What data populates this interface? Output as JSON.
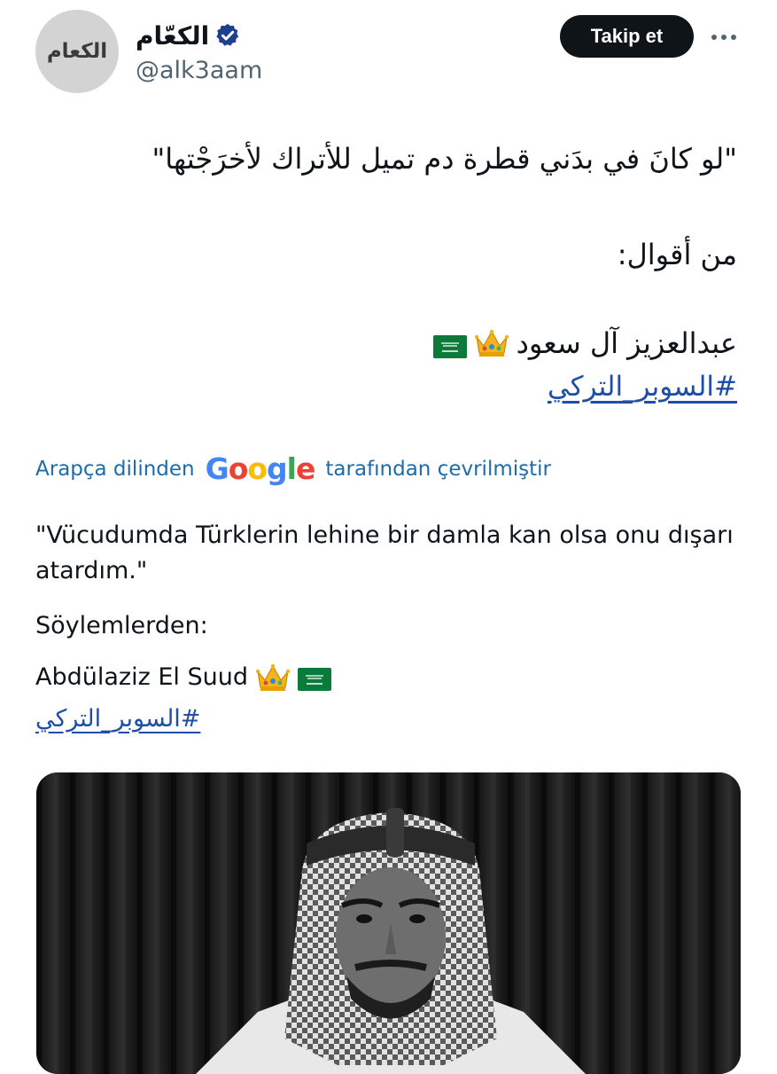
{
  "account": {
    "display_name": "الكعّام",
    "handle": "@alk3aam",
    "avatar_logo_text": "الكعام",
    "verified": true
  },
  "actions": {
    "follow_label": "Takip et",
    "more_icon": "more-dots-icon"
  },
  "tweet": {
    "arabic_line1": "\"لو كانَ في بدَني قطرة دم تميل للأتراك لأخرَجْتها\"",
    "arabic_line2": "من أقوال:",
    "arabic_line3": "عبدالعزيز آل سعود",
    "arabic_hashtag": "#السوبر_التركي"
  },
  "translation": {
    "prefix": "Arapça dilinden",
    "google": "Google",
    "suffix": "tarafından çevrilmiştir",
    "line1": "\"Vücudumda Türklerin lehine bir damla kan olsa onu dışarı atardım.\"",
    "line2": "Söylemlerden:",
    "line3": "Abdülaziz El Suud",
    "hashtag": "#السوبر_التركي"
  },
  "media": {
    "type": "photo"
  },
  "colors": {
    "verified_badge": "#1d3f8f",
    "link": "#1d4ea8",
    "translation_link": "#1d6ba8",
    "follow_button_bg": "#0f1419",
    "google_blue": "#4285F4",
    "google_red": "#EA4335",
    "google_yellow": "#FBBC05",
    "google_green": "#34A853"
  }
}
